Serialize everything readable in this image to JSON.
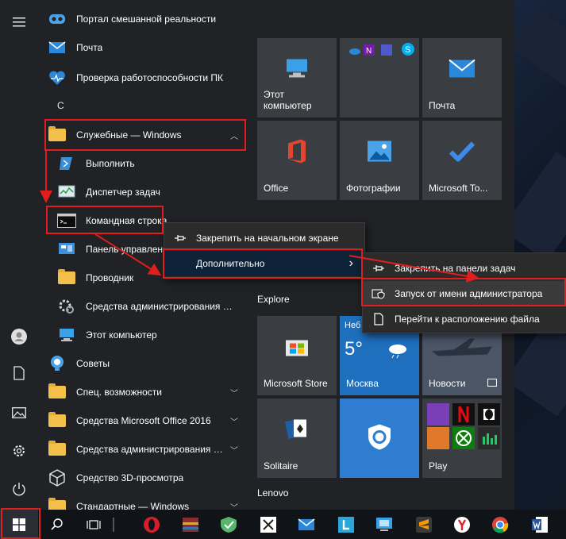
{
  "start_menu": {
    "app_list": [
      {
        "label": "Портал смешанной реальности",
        "icon": "mixed-reality-icon"
      },
      {
        "label": "Почта",
        "icon": "mail-icon"
      },
      {
        "label": "Проверка работоспособности ПК",
        "icon": "health-check-icon"
      },
      {
        "letter": "С"
      },
      {
        "label": "Служебные — Windows",
        "icon": "folder-icon",
        "expanded": true
      },
      {
        "label": "Выполнить",
        "icon": "run-icon"
      },
      {
        "label": "Диспетчер задач",
        "icon": "task-manager-icon"
      },
      {
        "label": "Командная строка",
        "icon": "command-prompt-icon"
      },
      {
        "label": "Панель управления",
        "icon": "control-panel-icon"
      },
      {
        "label": "Проводник",
        "icon": "explorer-icon"
      },
      {
        "label": "Средства администрирования Win...",
        "icon": "admin-tools-icon"
      },
      {
        "label": "Этот компьютер",
        "icon": "computer-icon"
      },
      {
        "label": "Советы",
        "icon": "tips-icon"
      },
      {
        "label": "Спец. возможности",
        "icon": "folder-icon"
      },
      {
        "label": "Средства Microsoft Office 2016",
        "icon": "folder-icon"
      },
      {
        "label": "Средства администрирования W...",
        "icon": "folder-icon"
      },
      {
        "label": "Средство 3D-просмотра",
        "icon": "3d-viewer-icon"
      },
      {
        "label": "Стандартные — Windows",
        "icon": "folder-icon"
      }
    ],
    "tiles": {
      "this_pc": "Этот\nкомпьютер",
      "mail": "Почта",
      "office": "Office",
      "photos": "Фотографии",
      "todo": "Microsoft To...",
      "explore_header": "Explore",
      "store": "Microsoft Store",
      "weather_day": "Неб",
      "weather_temp": "5°",
      "weather_city": "Москва",
      "news": "Новости",
      "solitaire": "Solitaire",
      "play": "Play",
      "lenovo_header": "Lenovo"
    }
  },
  "context_menu": {
    "pin_start": "Закрепить на начальном экране",
    "more": "Дополнительно",
    "more_arrow": "›"
  },
  "submenu": {
    "pin_taskbar": "Закрепить на панели задач",
    "run_as_admin": "Запуск от имени администратора",
    "open_location": "Перейти к расположению файла"
  },
  "colors": {
    "highlight": "#e01e1e",
    "folder": "#f3c14b",
    "menu_bg": "#202225",
    "tile_bg": "#3a3d41"
  }
}
